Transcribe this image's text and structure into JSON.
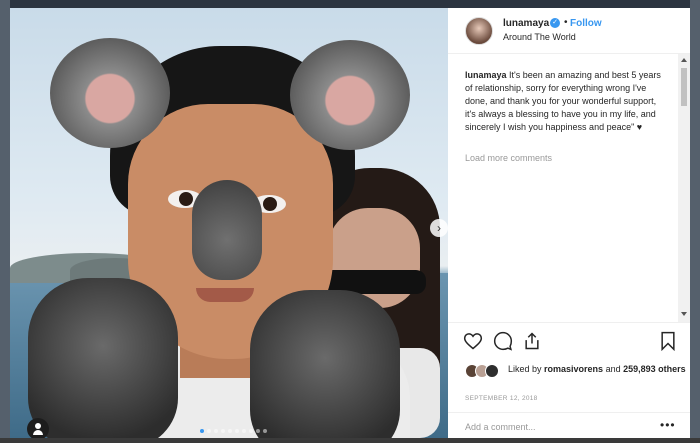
{
  "post": {
    "username": "lunamaya",
    "separator": "•",
    "follow_label": "Follow",
    "location": "Around The World",
    "caption_user": "lunamaya",
    "caption_text": "It's been an amazing and best 5 years of relationship, sorry for everything wrong I've done, and thank you for your wonderful support, it's always a blessing to have you in my life, and sincerely I wish you happiness and peace\" ♥",
    "load_more": "Load more comments",
    "liked_prefix": "Liked by ",
    "liked_user": "romasivorens",
    "liked_joiner": " and ",
    "liked_count": "259,893 others",
    "date": "SEPTEMBER 12, 2018",
    "comment_placeholder": "Add a comment...",
    "more_glyph": "•••",
    "next_glyph": "›",
    "verified_glyph": "✓"
  },
  "carousel": {
    "slides": 10,
    "active_index": 0
  },
  "colors": {
    "link": "#3897f0",
    "text": "#262626",
    "muted": "#999999"
  },
  "icons": [
    "heart-icon",
    "comment-icon",
    "share-icon",
    "bookmark-icon",
    "user-tag-icon",
    "verified-icon",
    "chevron-right-icon"
  ]
}
